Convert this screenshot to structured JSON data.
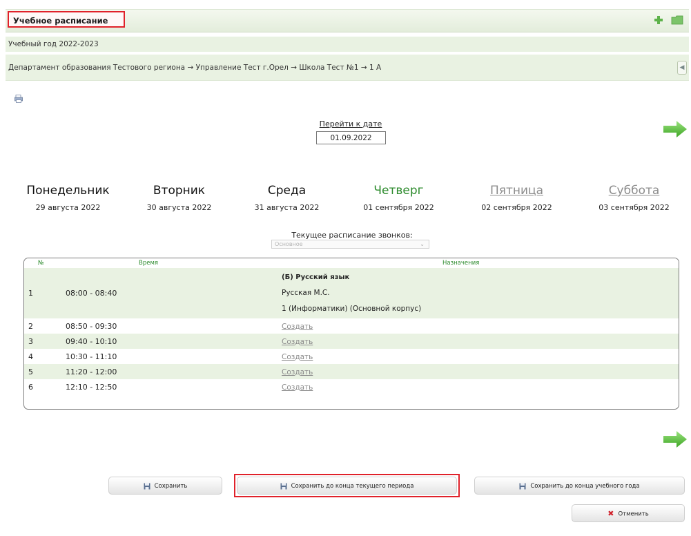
{
  "header": {
    "title": "Учебное расписание"
  },
  "school_year": "Учебный год 2022-2023",
  "breadcrumbs": "Департамент образования Тестового региона → Управление Тест г.Орел → Школа Тест №1 → 1 А",
  "goto_date": {
    "label": "Перейти к дате",
    "value": "01.09.2022"
  },
  "days": [
    {
      "name": "Понедельник",
      "date": "29 августа 2022"
    },
    {
      "name": "Вторник",
      "date": "30 августа 2022"
    },
    {
      "name": "Среда",
      "date": "31 августа 2022"
    },
    {
      "name": "Четверг",
      "date": "01 сентября 2022"
    },
    {
      "name": "Пятница",
      "date": "02 сентября 2022"
    },
    {
      "name": "Суббота",
      "date": "03 сентября 2022"
    }
  ],
  "bells": {
    "label": "Текущее расписание звонков:",
    "selected": "Основное"
  },
  "table": {
    "headers": {
      "num": "№",
      "time": "Время",
      "assign": "Назначения"
    },
    "lesson1": {
      "num": "1",
      "time": "08:00 - 08:40",
      "subject": "(Б) Русский язык",
      "teacher": "Русская М.С.",
      "room": "1 (Информатики) (Основной корпус)"
    },
    "rows": [
      {
        "num": "2",
        "time": "08:50 - 09:30",
        "action": "Создать"
      },
      {
        "num": "3",
        "time": "09:40 - 10:10",
        "action": "Создать"
      },
      {
        "num": "4",
        "time": "10:30 - 11:10",
        "action": "Создать"
      },
      {
        "num": "5",
        "time": "11:20 - 12:00",
        "action": "Создать"
      },
      {
        "num": "6",
        "time": "12:10 - 12:50",
        "action": "Создать"
      }
    ]
  },
  "buttons": {
    "save": "Сохранить",
    "save_period": "Сохранить до конца текущего периода",
    "save_year": "Сохранить до конца  учебного года",
    "cancel": "Отменить"
  },
  "colors": {
    "accent_green": "#2b8a2b",
    "highlight_red": "#e0212a",
    "row_green": "#e9f2e2"
  }
}
